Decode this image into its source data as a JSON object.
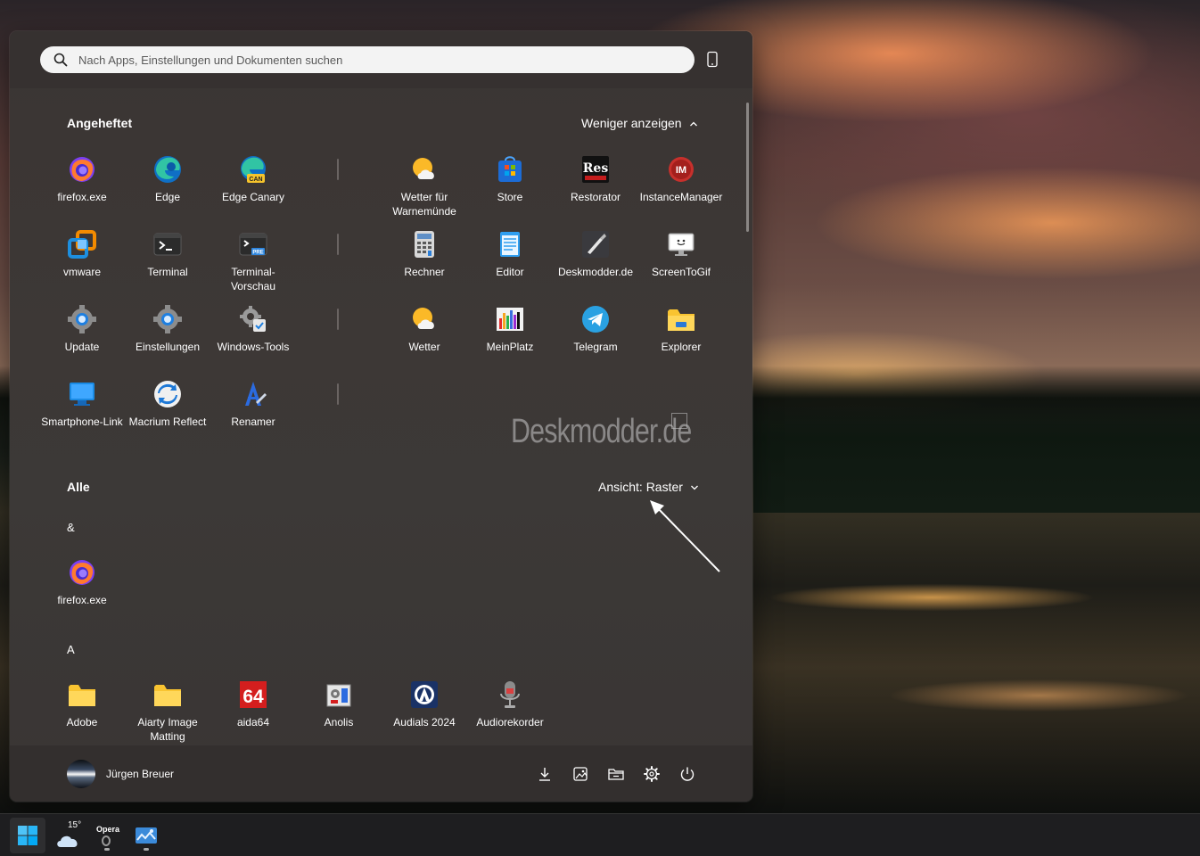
{
  "search": {
    "placeholder": "Nach Apps, Einstellungen und Dokumenten suchen"
  },
  "pinned": {
    "title": "Angeheftet",
    "toggle_label": "Weniger anzeigen",
    "apps": [
      {
        "label": "firefox.exe"
      },
      {
        "label": "Edge"
      },
      {
        "label": "Edge Canary"
      },
      {
        "label": "Wetter für Warnemünde"
      },
      {
        "label": "Store"
      },
      {
        "label": "Restorator"
      },
      {
        "label": "InstanceManager"
      },
      {
        "label": "vmware"
      },
      {
        "label": "Terminal"
      },
      {
        "label": "Terminal-Vorschau"
      },
      {
        "label": "Rechner"
      },
      {
        "label": "Editor"
      },
      {
        "label": "Deskmodder.de"
      },
      {
        "label": "ScreenToGif"
      },
      {
        "label": "Update"
      },
      {
        "label": "Einstellungen"
      },
      {
        "label": "Windows-Tools"
      },
      {
        "label": "Wetter"
      },
      {
        "label": "MeinPlatz"
      },
      {
        "label": "Telegram"
      },
      {
        "label": "Explorer"
      },
      {
        "label": "Smartphone-Link"
      },
      {
        "label": "Macrium Reflect"
      },
      {
        "label": "Renamer"
      }
    ]
  },
  "all": {
    "title": "Alle",
    "view_label": "Ansicht: Raster",
    "groups": [
      {
        "letter": "&",
        "apps": [
          {
            "label": "firefox.exe"
          }
        ]
      },
      {
        "letter": "A",
        "apps": [
          {
            "label": "Adobe"
          },
          {
            "label": "Aiarty Image Matting"
          },
          {
            "label": "aida64"
          },
          {
            "label": "Anolis"
          },
          {
            "label": "Audials 2024"
          },
          {
            "label": "Audiorekorder"
          }
        ]
      }
    ]
  },
  "watermark": "Deskmodder.de",
  "user": {
    "name": "Jürgen Breuer"
  },
  "icon_labels": {
    "edge_canary_badge": "CAN",
    "terminal_preview_badge": "PRE",
    "restorator_logo": "Res",
    "instancemanager_logo": "IM",
    "aida64_logo": "64"
  },
  "taskbar": {
    "weather_temp": "15°",
    "opera_label": "Opera"
  },
  "colors": {
    "accent": "#0a84ff",
    "panel": "#3b3634",
    "taskbar": "#1e1e20"
  }
}
